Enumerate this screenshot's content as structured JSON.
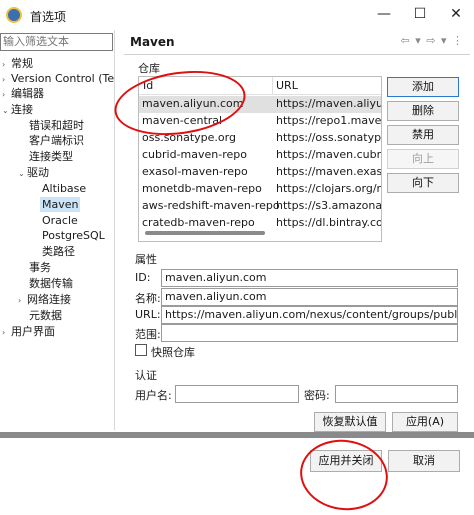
{
  "window": {
    "title": "首选项",
    "minimize_glyph": "—",
    "maximize_glyph": "☐",
    "close_glyph": "✕"
  },
  "filter": {
    "placeholder": "输入筛选文本"
  },
  "tree": [
    {
      "label": "常规",
      "caret": "›"
    },
    {
      "label": "Version Control (Te",
      "caret": "›"
    },
    {
      "label": "编辑器",
      "caret": "›"
    },
    {
      "label": "连接",
      "caret": "⌄"
    },
    {
      "label": "错误和超时"
    },
    {
      "label": "客户端标识"
    },
    {
      "label": "连接类型"
    },
    {
      "label": "驱动",
      "caret": "⌄"
    },
    {
      "label": "Altibase"
    },
    {
      "label": "Maven",
      "selected": true
    },
    {
      "label": "Oracle"
    },
    {
      "label": "PostgreSQL"
    },
    {
      "label": "类路径"
    },
    {
      "label": "事务"
    },
    {
      "label": "数据传输"
    },
    {
      "label": "网络连接",
      "caret": "›"
    },
    {
      "label": "元数据"
    },
    {
      "label": "用户界面",
      "caret": "›"
    }
  ],
  "page": {
    "title": "Maven",
    "nav_icons": "⇦ ▾ ⇨ ▾ ⋮"
  },
  "repo": {
    "group_label": "仓库",
    "columns": [
      "Id",
      "URL"
    ],
    "rows": [
      {
        "id": "maven.aliyun.com",
        "url": "https://maven.aliyun."
      },
      {
        "id": "maven-central",
        "url": "https://repo1.maven."
      },
      {
        "id": "oss.sonatype.org",
        "url": "https://oss.sonatype."
      },
      {
        "id": "cubrid-maven-repo",
        "url": "https://maven.cubrid"
      },
      {
        "id": "exasol-maven-repo",
        "url": "https://maven.exasol"
      },
      {
        "id": "monetdb-maven-repo",
        "url": "https://clojars.org/re"
      },
      {
        "id": "aws-redshift-maven-repo",
        "url": "https://s3.amazonaws"
      },
      {
        "id": "cratedb-maven-repo",
        "url": "https://dl.bintray.com"
      }
    ],
    "buttons": {
      "add": "添加",
      "remove": "删除",
      "disable": "禁用",
      "up": "向上",
      "down": "向下"
    }
  },
  "props": {
    "group_label": "属性",
    "id_label": "ID:",
    "id_value": "maven.aliyun.com",
    "name_label": "名称:",
    "name_value": "maven.aliyun.com",
    "url_label": "URL:",
    "url_value": "https://maven.aliyun.com/nexus/content/groups/public/",
    "scope_label": "范围:",
    "scope_value": "",
    "snapshot_label": "快照仓库"
  },
  "auth": {
    "group_label": "认证",
    "user_label": "用户名:",
    "password_label": "密码:"
  },
  "actions": {
    "restore_defaults": "恢复默认值(D)",
    "apply": "应用(A)"
  },
  "footer": {
    "apply_close": "应用并关闭",
    "cancel": "取消"
  },
  "colors": {
    "selection": "#cce4f7",
    "annotation": "#e01010"
  }
}
